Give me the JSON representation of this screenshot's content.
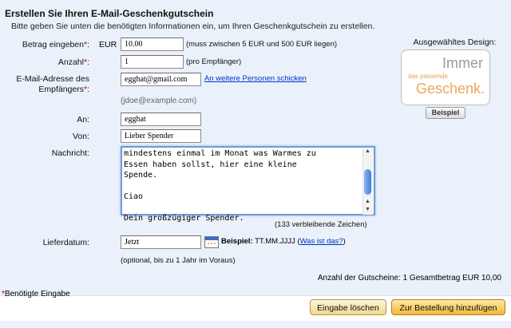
{
  "form": {
    "title": "Erstellen Sie Ihren E-Mail-Geschenkgutschein",
    "subtitle": "Bitte geben Sie unten die benötigten Informationen ein, um Ihren Geschenkgutschein zu erstellen.",
    "amount": {
      "label": "Betrag eingeben",
      "req": "*",
      "colon": ":",
      "currency": "EUR",
      "value": "10.00",
      "hint": "(muss zwischen 5 EUR und 500 EUR liegen)"
    },
    "quantity": {
      "label": "Anzahl",
      "req": "*",
      "colon": ":",
      "value": "1",
      "hint": "(pro Empfänger)"
    },
    "email": {
      "label_line1": "E-Mail-Adresse des",
      "label_line2": "Empfängers",
      "req": "*",
      "colon": ":",
      "value": "egghat@gmail.com",
      "more_link": "An weitere Personen schicken",
      "example": "(jdoe@example.com)"
    },
    "to": {
      "label": "An:",
      "value": "egghat"
    },
    "from": {
      "label": "Von:",
      "value": "Lieber Spender"
    },
    "message": {
      "label": "Nachricht:",
      "text": "mindestens einmal im Monat was Warmes zu\nEssen haben sollst, hier eine kleine\nSpende.\n\nCiao\n\nDein großzügiger Spender.",
      "remaining": "(133 verbleibende Zeichen)"
    },
    "delivery": {
      "label": "Lieferdatum:",
      "value": "Jetzt",
      "example_label": "Beispiel:",
      "example_value": "TT.MM.JJJJ",
      "paren_open": "(",
      "what_link": "Was ist das?",
      "paren_close": ")",
      "note": "(optional, bis zu 1 Jahr im Voraus)"
    },
    "summary": "Anzahl der Gutscheine: 1 Gesamtbetrag EUR 10,00"
  },
  "design": {
    "label": "Ausgewähltes Design:",
    "word1": "Immer",
    "word2": "das passende",
    "word3": "Geschenk.",
    "example_button": "Beispiel"
  },
  "footer": {
    "required_mark": "*",
    "required_note": "Benötigte Eingabe",
    "reset_button": "Eingabe löschen",
    "order_button": "Zur Bestellung hinzufügen"
  },
  "colors": {
    "panel": "#eaf1fa",
    "required": "#c00000",
    "link": "#0033cc",
    "order_button": "#f2b73a"
  }
}
